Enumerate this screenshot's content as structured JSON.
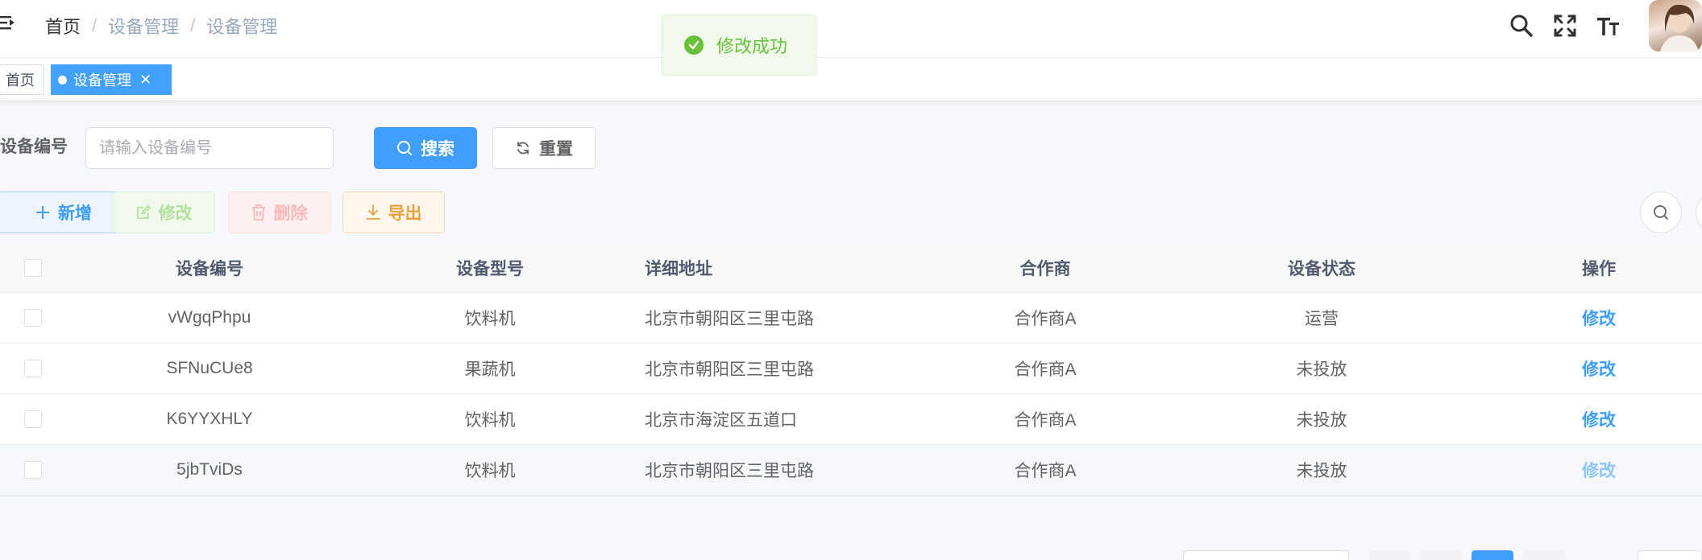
{
  "navbar": {
    "breadcrumb": [
      "首页",
      "设备管理",
      "设备管理"
    ],
    "icons": [
      "search-icon",
      "fullscreen-icon",
      "font-size-icon"
    ]
  },
  "toast": {
    "message": "修改成功",
    "icon": "check-circle-icon",
    "color": "#67c23a"
  },
  "tags": [
    {
      "label": "首页",
      "active": false
    },
    {
      "label": "设备管理",
      "active": true
    }
  ],
  "search": {
    "label": "设备编号",
    "placeholder": "请输入设备编号",
    "value": "",
    "search_button": "搜索",
    "reset_button": "重置"
  },
  "toolbar": {
    "add": "新增",
    "edit": "修改",
    "delete": "删除",
    "export": "导出"
  },
  "table": {
    "columns": [
      "设备编号",
      "设备型号",
      "详细地址",
      "合作商",
      "设备状态",
      "操作"
    ],
    "rows": [
      {
        "code": "vWgqPhpu",
        "model": "饮料机",
        "address": "北京市朝阳区三里屯路",
        "partner": "合作商A",
        "status": "运营",
        "action": "修改"
      },
      {
        "code": "SFNuCUe8",
        "model": "果蔬机",
        "address": "北京市朝阳区三里屯路",
        "partner": "合作商A",
        "status": "未投放",
        "action": "修改"
      },
      {
        "code": "K6YYXHLY",
        "model": "饮料机",
        "address": "北京市海淀区五道口",
        "partner": "合作商A",
        "status": "未投放",
        "action": "修改"
      },
      {
        "code": "5jbTviDs",
        "model": "饮料机",
        "address": "北京市朝阳区三里屯路",
        "partner": "合作商A",
        "status": "未投放",
        "action": "修改"
      }
    ]
  },
  "colors": {
    "primary": "#409eff",
    "success": "#67c23a",
    "danger": "#f56c6c",
    "warning": "#e6a23c",
    "tag_active": "#42a0ff"
  }
}
